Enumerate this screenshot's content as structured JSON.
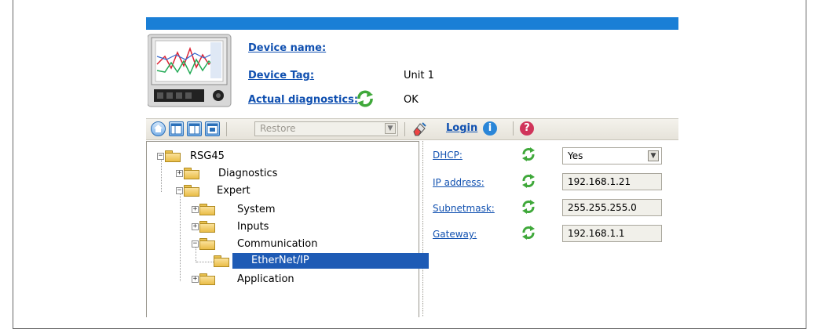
{
  "header": {
    "device_name_label": "Device name:",
    "device_name_value": "",
    "device_tag_label": "Device Tag:",
    "device_tag_value": "Unit 1",
    "diagnostics_label": "Actual diagnostics:",
    "diagnostics_value": "OK",
    "device_image_icon": "recorder-device-image"
  },
  "toolbar": {
    "restore_label": "Restore",
    "login_label": "Login",
    "icons": [
      "home-icon",
      "layout-icon",
      "layout-icon",
      "layout-icon",
      "eraser-icon",
      "info-icon",
      "help-icon"
    ]
  },
  "tree": {
    "root": "RSG45",
    "items": {
      "diagnostics": "Diagnostics",
      "expert": "Expert",
      "system": "System",
      "inputs": "Inputs",
      "communication": "Communication",
      "ethernetip": "EtherNet/IP",
      "application": "Application"
    },
    "selected": "EtherNet/IP"
  },
  "params": {
    "dhcp": {
      "label": "DHCP:",
      "value": "Yes"
    },
    "ip_address": {
      "label": "IP address:",
      "value": "192.168.1.21"
    },
    "subnetmask": {
      "label": "Subnetmask:",
      "value": "255.255.255.0"
    },
    "gateway": {
      "label": "Gateway:",
      "value": "192.168.1.1"
    }
  },
  "colors": {
    "title_bar": "#1a7fd6",
    "link": "#1050b0",
    "selection": "#1e5bb5",
    "refresh_green": "#3fa83a"
  }
}
